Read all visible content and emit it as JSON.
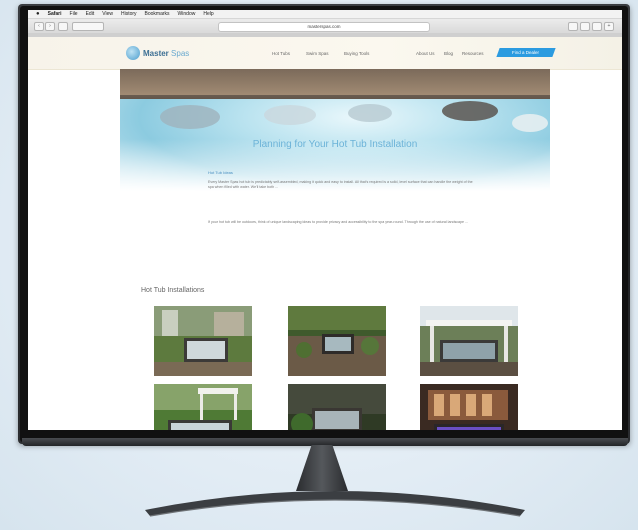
{
  "browser": {
    "menu_items": [
      "",
      "Safari",
      "File",
      "Edit",
      "View",
      "History",
      "Bookmarks",
      "Window",
      "Help"
    ],
    "url": "masterspas.com"
  },
  "site": {
    "brand": {
      "primary": "Master",
      "secondary": "Spas"
    },
    "nav": [
      "Hot Tubs",
      "Swim Spas",
      "Buying Tools"
    ],
    "nav_right": [
      "About Us",
      "Blog",
      "Resources"
    ],
    "cta": "Find a Dealer",
    "hero_title": "Planning for Your Hot Tub Installation",
    "intro_label": "Hot Tub Ideas",
    "paragraphs": [
      "Every Master Spas hot tub is predictably self-assembled, making it quick and easy to install. All that's required is a solid, level surface that can handle the weight of the spa when filled with water. We'll take both ...",
      "If your hot tub will be outdoors, think of unique landscaping ideas to provide privacy and accessibility to the spa year-round. Through the use of natural landscape ..."
    ],
    "gallery_title": "Hot Tub Installations"
  },
  "colors": {
    "accent": "#2b9be0",
    "title_blue": "#6cb3d8",
    "bezel": "#1f2124"
  }
}
